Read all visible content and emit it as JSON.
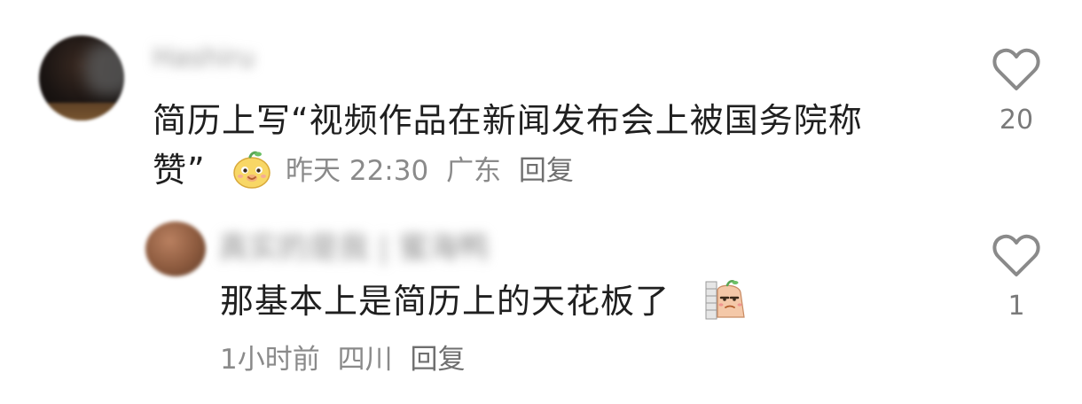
{
  "main_comment": {
    "username": "Hashiru",
    "text_line1": "简历上写“视频作品在新闻发布会上被国务院称",
    "text_line2": "赞”",
    "time": "昨天 22:30",
    "location": "广东",
    "reply_label": "回复",
    "likes": "20",
    "sticker_icon": "pear-mascot-smile-icon"
  },
  "reply_comment": {
    "username": "真实的是我 | 蜜海鸭",
    "text": "那基本上是简历上的天花板了",
    "time": "1小时前",
    "location": "四川",
    "reply_label": "回复",
    "likes": "1",
    "sticker_icon": "pear-mascot-peek-icon"
  },
  "colors": {
    "text": "#1f1f1f",
    "meta": "#8a8a8a",
    "heart_outline": "#8a8a8a",
    "background": "#ffffff"
  }
}
